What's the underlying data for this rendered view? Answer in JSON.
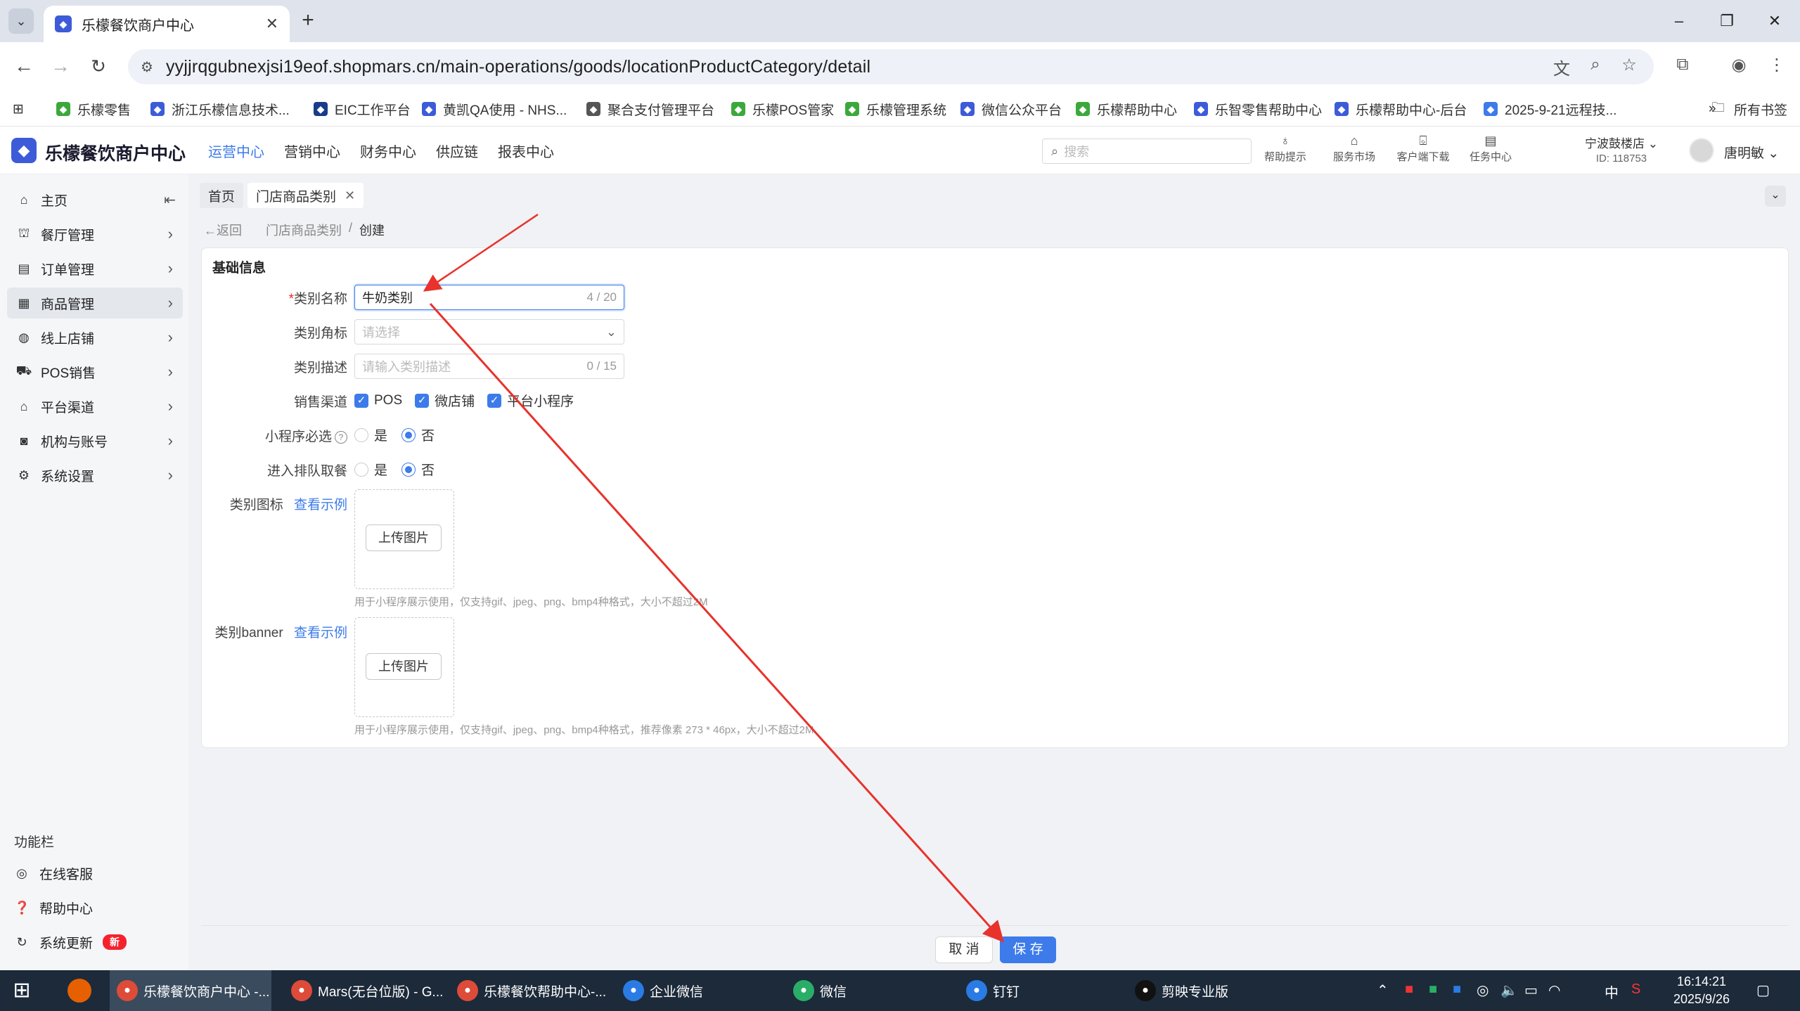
{
  "browser": {
    "tab_title": "乐檬餐饮商户中心",
    "url": "yyjjrqgubnexjsi19eof.shopmars.cn/main-operations/goods/locationProductCategory/detail",
    "bookmarks": [
      {
        "label": "乐檬零售",
        "color": "#3ca83c"
      },
      {
        "label": "浙江乐檬信息技术...",
        "color": "#3d5bd9"
      },
      {
        "label": "EIC工作平台",
        "color": "#1a3b8a"
      },
      {
        "label": "黄凯QA使用 - NHS...",
        "color": "#3d5bd9"
      },
      {
        "label": "聚合支付管理平台",
        "color": "#555555"
      },
      {
        "label": "乐檬POS管家",
        "color": "#3ca83c"
      },
      {
        "label": "乐檬管理系统",
        "color": "#3ca83c"
      },
      {
        "label": "微信公众平台",
        "color": "#3d5bd9"
      },
      {
        "label": "乐檬帮助中心",
        "color": "#3ca83c"
      },
      {
        "label": "乐智零售帮助中心",
        "color": "#3d5bd9"
      },
      {
        "label": "乐檬帮助中心-后台",
        "color": "#3d5bd9"
      },
      {
        "label": "2025-9-21远程技...",
        "color": "#3d7bea"
      }
    ],
    "all_bookmarks": "所有书签"
  },
  "app": {
    "logo_text": "乐檬餐饮商户中心",
    "nav": [
      "运营中心",
      "营销中心",
      "财务中心",
      "供应链",
      "报表中心"
    ],
    "search_placeholder": "搜索",
    "tools": [
      "帮助提示",
      "服务市场",
      "客户端下载",
      "任务中心"
    ],
    "store_name": "宁波鼓楼店",
    "store_id": "ID: 118753",
    "user_name": "唐明敏"
  },
  "sidebar": {
    "items": [
      {
        "label": "主页",
        "icon": "home-icon"
      },
      {
        "label": "餐厅管理",
        "icon": "shop-icon"
      },
      {
        "label": "订单管理",
        "icon": "order-icon"
      },
      {
        "label": "商品管理",
        "icon": "goods-icon"
      },
      {
        "label": "线上店铺",
        "icon": "globe-icon"
      },
      {
        "label": "POS销售",
        "icon": "cart-icon"
      },
      {
        "label": "平台渠道",
        "icon": "bank-icon"
      },
      {
        "label": "机构与账号",
        "icon": "account-icon"
      },
      {
        "label": "系统设置",
        "icon": "gear-icon"
      }
    ],
    "func_title": "功能栏",
    "func_items": [
      "在线客服",
      "帮助中心",
      "系统更新"
    ],
    "new_badge": "新"
  },
  "page": {
    "tabs": [
      "首页",
      "门店商品类别"
    ],
    "back": "返回",
    "breadcrumb": [
      "门店商品类别",
      "/",
      "创建"
    ],
    "section_title": "基础信息",
    "form": {
      "name_label": "类别名称",
      "name_value": "牛奶类别",
      "name_count": "4 / 20",
      "badge_label": "类别角标",
      "badge_placeholder": "请选择",
      "desc_label": "类别描述",
      "desc_placeholder": "请输入类别描述",
      "desc_count": "0 / 15",
      "channel_label": "销售渠道",
      "channels": [
        "POS",
        "微店铺",
        "平台小程序"
      ],
      "required_label": "小程序必选",
      "queue_label": "进入排队取餐",
      "yes": "是",
      "no": "否",
      "icon_label": "类别图标",
      "banner_label": "类别banner",
      "example_link": "查看示例",
      "upload_label": "上传图片",
      "icon_tip": "用于小程序展示使用，仅支持gif、jpeg、png、bmp4种格式，大小不超过2M",
      "banner_tip": "用于小程序展示使用，仅支持gif、jpeg、png、bmp4种格式，推荐像素 273 * 46px，大小不超过2M"
    },
    "cancel": "取 消",
    "save": "保 存"
  },
  "taskbar": {
    "items": [
      {
        "label": "乐檬餐饮商户中心 -...",
        "color": "#dd4b39"
      },
      {
        "label": "Mars(无台位版) - G...",
        "color": "#dd4b39"
      },
      {
        "label": "乐檬餐饮帮助中心-...",
        "color": "#dd4b39"
      },
      {
        "label": "企业微信",
        "color": "#2a7be4"
      },
      {
        "label": "微信",
        "color": "#2aae67"
      },
      {
        "label": "钉钉",
        "color": "#2a7be4"
      },
      {
        "label": "剪映专业版",
        "color": "#111111"
      }
    ],
    "ime": "中",
    "time": "16:14:21",
    "date": "2025/9/26"
  }
}
